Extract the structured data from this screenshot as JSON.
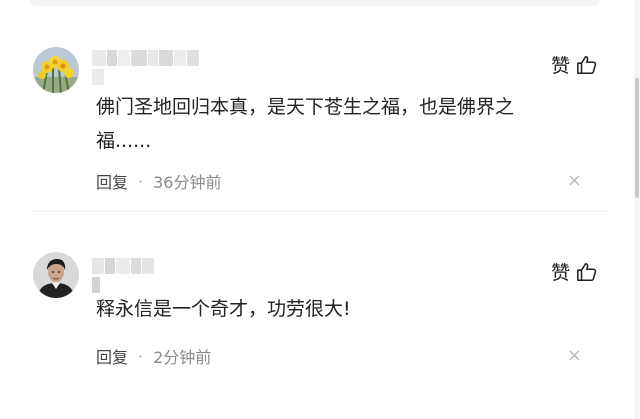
{
  "comments": [
    {
      "text": "佛门圣地回归本真，是天下苍生之福，也是佛界之福......",
      "like_label": "赞",
      "reply_label": "回复",
      "separator": "·",
      "time": "36分钟前",
      "close_glyph": "×",
      "avatar_icon": "daffodil-flowers-avatar"
    },
    {
      "text": "释永信是一个奇才，功劳很大!",
      "like_label": "赞",
      "reply_label": "回复",
      "separator": "·",
      "time": "2分钟前",
      "close_glyph": "×",
      "avatar_icon": "man-portrait-avatar"
    }
  ],
  "colors": {
    "text": "#222222",
    "meta": "#8a8a8a",
    "close": "#bdbdbd"
  }
}
